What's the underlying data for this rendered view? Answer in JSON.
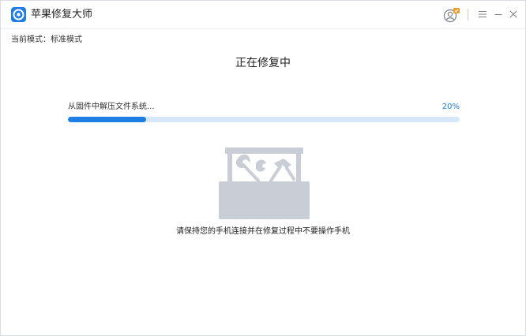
{
  "app": {
    "title": "苹果修复大师"
  },
  "mode": {
    "label": "当前模式：",
    "value": "标准模式"
  },
  "main": {
    "title": "正在修复中",
    "step_label": "从固件中解压文件系统...",
    "progress_percent": 20,
    "progress_text": "20%",
    "hint": "请保持您的手机连接并在修复过程中不要操作手机"
  },
  "icons": {
    "logo": "app-logo-icon",
    "user": "user-account-icon",
    "menu": "menu-icon",
    "minimize": "minimize-icon",
    "close": "close-icon",
    "illustration": "toolbox-icon"
  },
  "colors": {
    "accent": "#1f7ee6",
    "track": "#d6e8fa",
    "illustration": "#c9ced6",
    "badge": "#f39b28"
  }
}
